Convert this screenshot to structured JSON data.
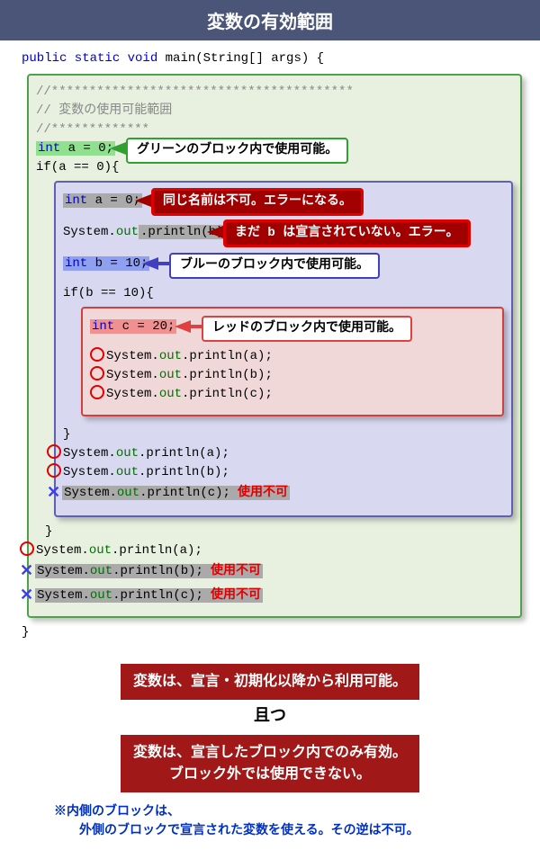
{
  "header": {
    "title": "変数の有効範囲"
  },
  "code": {
    "main_sig": {
      "kw1": "public static void",
      "name": " main(String[] args) {"
    },
    "star1": "//****************************************",
    "comment1": "// 変数の使用可能範囲",
    "star2": "//*************",
    "decl_a": {
      "type": "int",
      "rest": " a = 0;"
    },
    "if_a": "if(a == 0){",
    "decl_a2": {
      "type": "int",
      "rest": " a = 0;"
    },
    "print_b1": {
      "pre": "System.",
      "out": "out",
      "post": ".println(b);"
    },
    "decl_b": {
      "type": "int",
      "rest": " b = 10;"
    },
    "if_b": "if(b == 10){",
    "decl_c": {
      "type": "int",
      "rest": " c = 20;"
    },
    "print_a": {
      "pre": "System.",
      "out": "out",
      "post": ".println(a);"
    },
    "print_b": {
      "pre": "System.",
      "out": "out",
      "post": ".println(b);"
    },
    "print_c": {
      "pre": "System.",
      "out": "out",
      "post": ".println(c);"
    },
    "brace": "}",
    "unusable": "使用不可"
  },
  "callouts": {
    "green": "グリーンのブロック内で使用可能。",
    "red1": "同じ名前は不可。エラーになる。",
    "red2": "まだ b は宣言されていない。エラー。",
    "blue": "ブルーのブロック内で使用可能。",
    "pink": "レッドのブロック内で使用可能。"
  },
  "summary": {
    "line1": "変数は、宣言・初期化以降から利用可能。",
    "and": "且つ",
    "line2a": "変数は、宣言したブロック内でのみ有効。",
    "line2b": "ブロック外では使用できない。"
  },
  "note": {
    "l1": "※内側のブロックは、",
    "l2": "外側のブロックで宣言された変数を使える。その逆は不可。"
  }
}
